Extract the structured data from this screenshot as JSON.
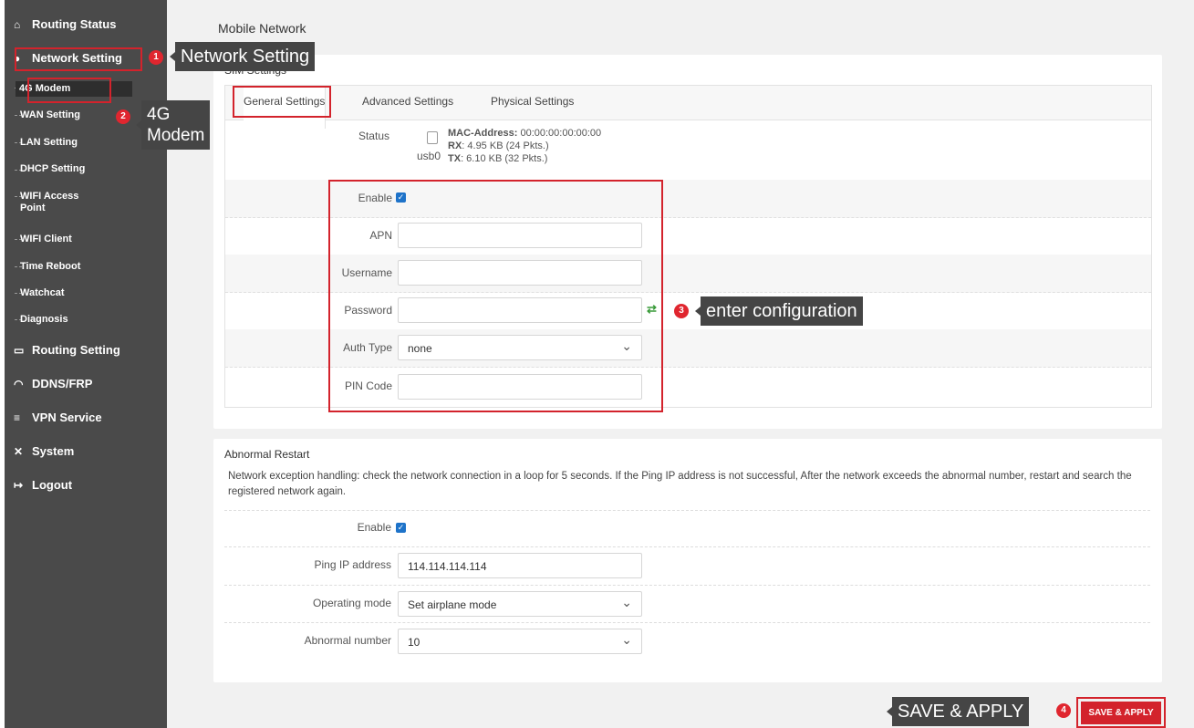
{
  "sidebar": {
    "routing_status": "Routing Status",
    "network_setting": "Network Setting",
    "sub_items": [
      "4G Modem",
      "WAN Setting",
      "LAN Setting",
      "DHCP Setting",
      "WIFI Access Point",
      "WIFI Client",
      "Time Reboot",
      "Watchcat",
      "Diagnosis"
    ],
    "routing_setting": "Routing Setting",
    "ddns": "DDNS/FRP",
    "vpn": "VPN Service",
    "system": "System",
    "logout": "Logout"
  },
  "page": {
    "title": "Mobile Network",
    "sim_legend": "SIM Settings",
    "tabs": [
      "General Settings",
      "Advanced Settings",
      "Physical Settings"
    ]
  },
  "status": {
    "label": "Status",
    "iface": "usb0",
    "mac_label": "MAC-Address:",
    "mac": "00:00:00:00:00:00",
    "rx_label": "RX",
    "rx": ": 4.95 KB (24 Pkts.)",
    "tx_label": "TX",
    "tx": ": 6.10 KB (32 Pkts.)"
  },
  "form": {
    "enable_label": "Enable",
    "apn_label": "APN",
    "apn_value": "",
    "username_label": "Username",
    "username_value": "",
    "password_label": "Password",
    "password_value": "",
    "auth_label": "Auth Type",
    "auth_value": "none",
    "pin_label": "PIN Code",
    "pin_value": ""
  },
  "restart": {
    "legend": "Abnormal Restart",
    "description": "Network exception handling: check the network connection in a loop for 5 seconds. If the Ping IP address is not successful, After the network exceeds the abnormal number, restart and search the registered network again.",
    "enable_label": "Enable",
    "ping_label": "Ping IP address",
    "ping_value": "114.114.114.114",
    "mode_label": "Operating mode",
    "mode_value": "Set airplane mode",
    "number_label": "Abnormal number",
    "number_value": "10"
  },
  "save_button": "SAVE & APPLY",
  "annotations": {
    "badge1": "1",
    "callout1": "Network Setting",
    "badge2": "2",
    "callout2_line1": "4G",
    "callout2_line2": "Modem",
    "badge3": "3",
    "callout3": "enter configuration",
    "badge4": "4",
    "callout4": "SAVE & APPLY"
  },
  "icons": {
    "home": "home-icon",
    "network": "globe-icon",
    "routing": "calendar-icon",
    "ddns": "gauge-icon",
    "vpn": "list-icon",
    "system": "tools-icon",
    "logout": "logout-icon",
    "password_toggle": "reveal-password-icon",
    "device": "device-icon",
    "check": "checkbox-checked"
  },
  "colors": {
    "accent": "#d3232c",
    "checkbox": "#1e73c9",
    "sidebar": "#4a4a4a"
  }
}
